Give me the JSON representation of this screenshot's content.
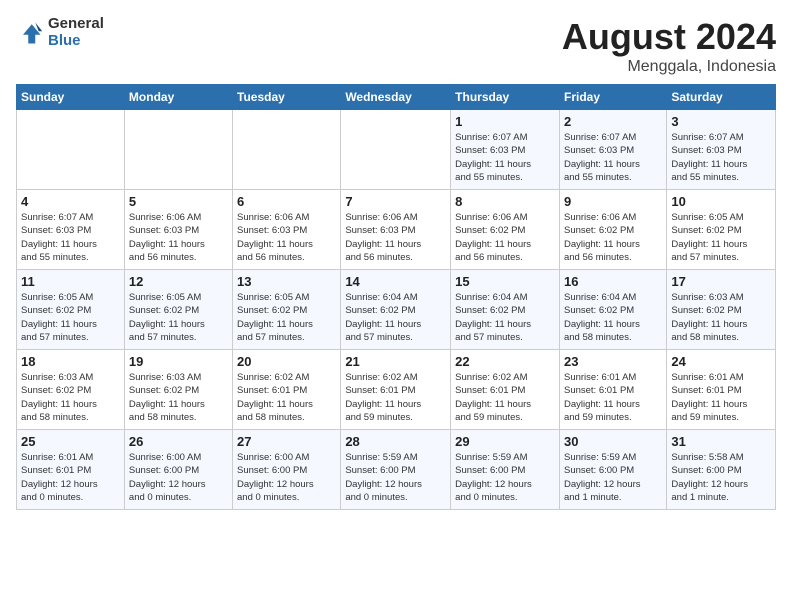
{
  "logo": {
    "general": "General",
    "blue": "Blue"
  },
  "header": {
    "month": "August 2024",
    "location": "Menggala, Indonesia"
  },
  "weekdays": [
    "Sunday",
    "Monday",
    "Tuesday",
    "Wednesday",
    "Thursday",
    "Friday",
    "Saturday"
  ],
  "weeks": [
    [
      {
        "day": "",
        "info": ""
      },
      {
        "day": "",
        "info": ""
      },
      {
        "day": "",
        "info": ""
      },
      {
        "day": "",
        "info": ""
      },
      {
        "day": "1",
        "info": "Sunrise: 6:07 AM\nSunset: 6:03 PM\nDaylight: 11 hours\nand 55 minutes."
      },
      {
        "day": "2",
        "info": "Sunrise: 6:07 AM\nSunset: 6:03 PM\nDaylight: 11 hours\nand 55 minutes."
      },
      {
        "day": "3",
        "info": "Sunrise: 6:07 AM\nSunset: 6:03 PM\nDaylight: 11 hours\nand 55 minutes."
      }
    ],
    [
      {
        "day": "4",
        "info": "Sunrise: 6:07 AM\nSunset: 6:03 PM\nDaylight: 11 hours\nand 55 minutes."
      },
      {
        "day": "5",
        "info": "Sunrise: 6:06 AM\nSunset: 6:03 PM\nDaylight: 11 hours\nand 56 minutes."
      },
      {
        "day": "6",
        "info": "Sunrise: 6:06 AM\nSunset: 6:03 PM\nDaylight: 11 hours\nand 56 minutes."
      },
      {
        "day": "7",
        "info": "Sunrise: 6:06 AM\nSunset: 6:03 PM\nDaylight: 11 hours\nand 56 minutes."
      },
      {
        "day": "8",
        "info": "Sunrise: 6:06 AM\nSunset: 6:02 PM\nDaylight: 11 hours\nand 56 minutes."
      },
      {
        "day": "9",
        "info": "Sunrise: 6:06 AM\nSunset: 6:02 PM\nDaylight: 11 hours\nand 56 minutes."
      },
      {
        "day": "10",
        "info": "Sunrise: 6:05 AM\nSunset: 6:02 PM\nDaylight: 11 hours\nand 57 minutes."
      }
    ],
    [
      {
        "day": "11",
        "info": "Sunrise: 6:05 AM\nSunset: 6:02 PM\nDaylight: 11 hours\nand 57 minutes."
      },
      {
        "day": "12",
        "info": "Sunrise: 6:05 AM\nSunset: 6:02 PM\nDaylight: 11 hours\nand 57 minutes."
      },
      {
        "day": "13",
        "info": "Sunrise: 6:05 AM\nSunset: 6:02 PM\nDaylight: 11 hours\nand 57 minutes."
      },
      {
        "day": "14",
        "info": "Sunrise: 6:04 AM\nSunset: 6:02 PM\nDaylight: 11 hours\nand 57 minutes."
      },
      {
        "day": "15",
        "info": "Sunrise: 6:04 AM\nSunset: 6:02 PM\nDaylight: 11 hours\nand 57 minutes."
      },
      {
        "day": "16",
        "info": "Sunrise: 6:04 AM\nSunset: 6:02 PM\nDaylight: 11 hours\nand 58 minutes."
      },
      {
        "day": "17",
        "info": "Sunrise: 6:03 AM\nSunset: 6:02 PM\nDaylight: 11 hours\nand 58 minutes."
      }
    ],
    [
      {
        "day": "18",
        "info": "Sunrise: 6:03 AM\nSunset: 6:02 PM\nDaylight: 11 hours\nand 58 minutes."
      },
      {
        "day": "19",
        "info": "Sunrise: 6:03 AM\nSunset: 6:02 PM\nDaylight: 11 hours\nand 58 minutes."
      },
      {
        "day": "20",
        "info": "Sunrise: 6:02 AM\nSunset: 6:01 PM\nDaylight: 11 hours\nand 58 minutes."
      },
      {
        "day": "21",
        "info": "Sunrise: 6:02 AM\nSunset: 6:01 PM\nDaylight: 11 hours\nand 59 minutes."
      },
      {
        "day": "22",
        "info": "Sunrise: 6:02 AM\nSunset: 6:01 PM\nDaylight: 11 hours\nand 59 minutes."
      },
      {
        "day": "23",
        "info": "Sunrise: 6:01 AM\nSunset: 6:01 PM\nDaylight: 11 hours\nand 59 minutes."
      },
      {
        "day": "24",
        "info": "Sunrise: 6:01 AM\nSunset: 6:01 PM\nDaylight: 11 hours\nand 59 minutes."
      }
    ],
    [
      {
        "day": "25",
        "info": "Sunrise: 6:01 AM\nSunset: 6:01 PM\nDaylight: 12 hours\nand 0 minutes."
      },
      {
        "day": "26",
        "info": "Sunrise: 6:00 AM\nSunset: 6:00 PM\nDaylight: 12 hours\nand 0 minutes."
      },
      {
        "day": "27",
        "info": "Sunrise: 6:00 AM\nSunset: 6:00 PM\nDaylight: 12 hours\nand 0 minutes."
      },
      {
        "day": "28",
        "info": "Sunrise: 5:59 AM\nSunset: 6:00 PM\nDaylight: 12 hours\nand 0 minutes."
      },
      {
        "day": "29",
        "info": "Sunrise: 5:59 AM\nSunset: 6:00 PM\nDaylight: 12 hours\nand 0 minutes."
      },
      {
        "day": "30",
        "info": "Sunrise: 5:59 AM\nSunset: 6:00 PM\nDaylight: 12 hours\nand 1 minute."
      },
      {
        "day": "31",
        "info": "Sunrise: 5:58 AM\nSunset: 6:00 PM\nDaylight: 12 hours\nand 1 minute."
      }
    ]
  ]
}
